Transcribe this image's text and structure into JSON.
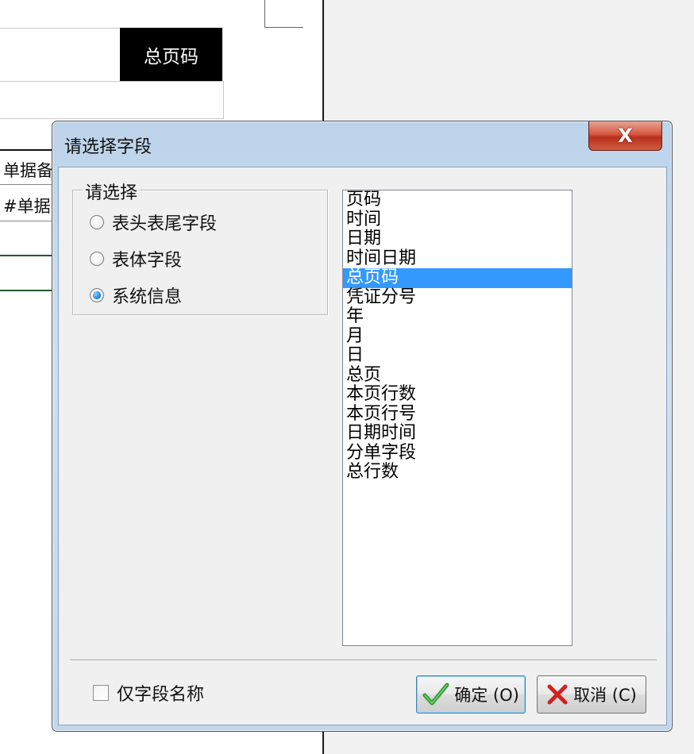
{
  "background": {
    "black_cell_text": "总页码",
    "table_header_text": "单据备",
    "table_cell_text": "#单据"
  },
  "dialog": {
    "title": "请选择字段",
    "close_glyph": "X",
    "group": {
      "legend": "请选择",
      "options": [
        {
          "label": "表头表尾字段",
          "checked": false
        },
        {
          "label": "表体字段",
          "checked": false
        },
        {
          "label": "系统信息",
          "checked": true
        }
      ]
    },
    "field_list": {
      "items": [
        "页码",
        "时间",
        "日期",
        "时间日期",
        "总页码",
        "凭证分号",
        "年",
        "月",
        "日",
        "总页",
        "本页行数",
        "本页行号",
        "日期时间",
        "分单字段",
        "总行数"
      ],
      "selected": "总页码"
    },
    "name_only_checkbox": {
      "label": "仅字段名称",
      "checked": false
    },
    "ok_button": "确定 (O)",
    "cancel_button": "取消 (C)"
  },
  "colors": {
    "selection": "#3399ff",
    "ok_icon": "#2e9a2e",
    "cancel_icon": "#d32020"
  }
}
